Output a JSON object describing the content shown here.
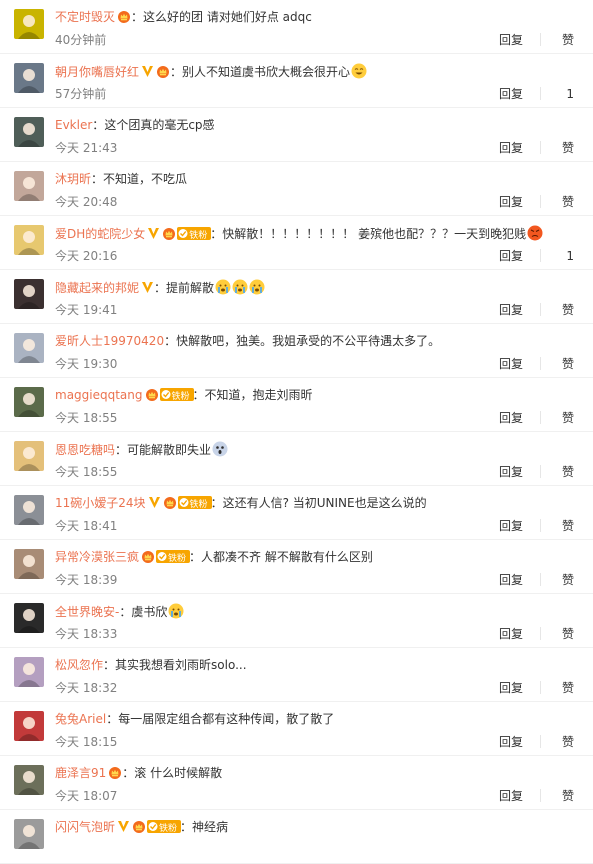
{
  "ui": {
    "reply_label": "回复",
    "like_label": "赞"
  },
  "colors": {
    "username": "#eb7350",
    "timestamp": "#808080",
    "text": "#333333",
    "vip_orange": "#f7a500",
    "fan_badge": "#f7a500"
  },
  "comments": [
    {
      "user": "不定时毁灭",
      "v": false,
      "crown": true,
      "fan": false,
      "text": "这么好的团 请对她们好点 adqc",
      "emoji_tail": [],
      "time": "40分钟前",
      "like": "赞",
      "avatar_color": "#c9b400"
    },
    {
      "user": "朝月你嘴唇好红",
      "v": true,
      "crown": true,
      "fan": false,
      "text": "别人不知道虞书欣大概会很开心",
      "emoji_tail": [
        "laugh"
      ],
      "time": "57分钟前",
      "like": "1",
      "avatar_color": "#6a7888"
    },
    {
      "user": "Evkler",
      "v": false,
      "crown": false,
      "fan": false,
      "text": "这个团真的毫无cp感",
      "emoji_tail": [],
      "time": "今天 21:43",
      "like": "赞",
      "avatar_color": "#4f5e58"
    },
    {
      "user": "沐玥昕",
      "v": false,
      "crown": false,
      "fan": false,
      "text": "不知道，不吃瓜",
      "emoji_tail": [],
      "time": "今天 20:48",
      "like": "赞",
      "avatar_color": "#c2a79a"
    },
    {
      "user": "爱DH的蛇院少女",
      "v": true,
      "crown": true,
      "fan": true,
      "fan_label": "铁粉",
      "text": "快解散！！！！！！！！ 姜殡他也配？？？一天到晚犯贱",
      "emoji_tail": [
        "angry"
      ],
      "time": "今天 20:16",
      "like": "1",
      "avatar_color": "#e7c86f"
    },
    {
      "user": "隐藏起来的邦妮",
      "v": true,
      "crown": false,
      "fan": false,
      "text": "提前解散",
      "emoji_tail": [
        "cry",
        "cry",
        "cry"
      ],
      "time": "今天 19:41",
      "like": "赞",
      "avatar_color": "#3b3030"
    },
    {
      "user": "爱昕人士19970420",
      "v": false,
      "crown": false,
      "fan": false,
      "text": "快解散吧，独美。我姐承受的不公平待遇太多了。",
      "emoji_tail": [],
      "time": "今天 19:30",
      "like": "赞",
      "avatar_color": "#aab3c2"
    },
    {
      "user": "maggieqqtang",
      "v": false,
      "crown": true,
      "fan": true,
      "fan_label": "铁粉",
      "text": "不知道，抱走刘雨昕",
      "emoji_tail": [],
      "time": "今天 18:55",
      "like": "赞",
      "avatar_color": "#5b6b4a"
    },
    {
      "user": "恩恩吃糖吗",
      "v": false,
      "crown": false,
      "fan": false,
      "text": "可能解散即失业",
      "emoji_tail": [
        "shock"
      ],
      "time": "今天 18:55",
      "like": "赞",
      "avatar_color": "#e4c07a"
    },
    {
      "user": "11碗小嫒子24块",
      "v": true,
      "crown": true,
      "fan": true,
      "fan_label": "铁粉",
      "text": "这还有人信? 当初UNINE也是这么说的",
      "emoji_tail": [],
      "time": "今天 18:41",
      "like": "赞",
      "avatar_color": "#8b8f96"
    },
    {
      "user": "异常冷漠张三疯",
      "v": false,
      "crown": true,
      "fan": true,
      "fan_label": "铁粉",
      "text": "人都凑不齐 解不解散有什么区别",
      "emoji_tail": [],
      "time": "今天 18:39",
      "like": "赞",
      "avatar_color": "#a88c76"
    },
    {
      "user": "全世界晚安-",
      "v": false,
      "crown": false,
      "fan": false,
      "text": "虞书欣",
      "emoji_tail": [
        "cry"
      ],
      "time": "今天 18:33",
      "like": "赞",
      "avatar_color": "#2a2a2a"
    },
    {
      "user": "松风忽作",
      "v": false,
      "crown": false,
      "fan": false,
      "text": "其实我想看刘雨昕solo...",
      "emoji_tail": [],
      "time": "今天 18:32",
      "like": "赞",
      "avatar_color": "#b49fc0"
    },
    {
      "user": "兔兔Ariel",
      "v": false,
      "crown": false,
      "fan": false,
      "text": "每一届限定组合都有这种传闻，散了散了",
      "emoji_tail": [],
      "time": "今天 18:15",
      "like": "赞",
      "avatar_color": "#c23a3a"
    },
    {
      "user": "鹿泽言91",
      "v": false,
      "crown": true,
      "fan": false,
      "text": "滚 什么时候解散",
      "emoji_tail": [],
      "time": "今天 18:07",
      "like": "赞",
      "avatar_color": "#6c6f5a"
    },
    {
      "user": "闪闪气泡昕",
      "v": true,
      "crown": true,
      "fan": true,
      "fan_label": "铁粉",
      "text": "神经病",
      "emoji_tail": [],
      "time": "",
      "like": "",
      "avatar_color": "#9b9b9b"
    }
  ]
}
